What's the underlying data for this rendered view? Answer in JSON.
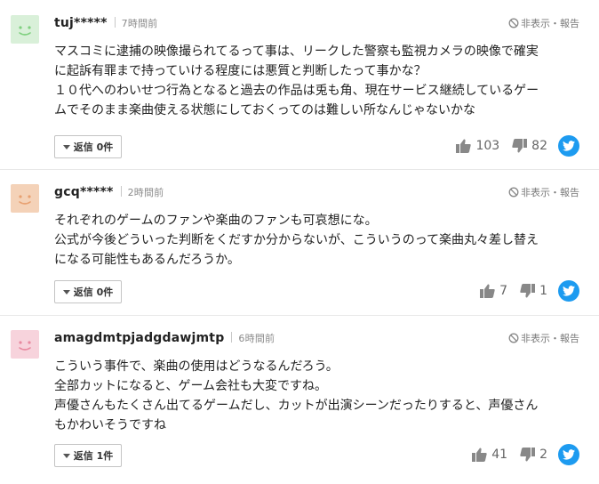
{
  "comments": [
    {
      "avatar_color": "#7fd07f",
      "avatar_bg": "#d9f0d9",
      "username": "tuj*****",
      "time": "7時間前",
      "report_label": "非表示・報告",
      "lines": [
        "マスコミに逮捕の映像撮られてるって事は、リークした警察も監視カメラの映像で確実",
        "に起訴有罪まで持っていける程度には悪質と判断したって事かな？",
        "１０代へのわいせつ行為となると過去の作品は兎も角、現在サービス継続しているゲー",
        "ムでそのまま楽曲使える状態にしておくってのは難しい所なんじゃないかな"
      ],
      "reply_label": "返信 0件",
      "likes": "103",
      "dislikes": "82"
    },
    {
      "avatar_color": "#e8a070",
      "avatar_bg": "#f4d2b8",
      "username": "gcq*****",
      "time": "2時間前",
      "report_label": "非表示・報告",
      "lines": [
        "それぞれのゲームのファンや楽曲のファンも可哀想にな。",
        "公式が今後どういった判断をくだすか分からないが、こういうのって楽曲丸々差し替え",
        "になる可能性もあるんだろうか。"
      ],
      "reply_label": "返信 0件",
      "likes": "7",
      "dislikes": "1"
    },
    {
      "avatar_color": "#e88aa0",
      "avatar_bg": "#f7d3dc",
      "username": "amagdmtpjadgdawjmtp",
      "time": "6時間前",
      "report_label": "非表示・報告",
      "lines": [
        "こういう事件で、楽曲の使用はどうなるんだろう。",
        "全部カットになると、ゲーム会社も大変ですね。",
        "声優さんもたくさん出てるゲームだし、カットが出演シーンだったりすると、声優さん",
        "もかわいそうですね"
      ],
      "reply_label": "返信 1件",
      "likes": "41",
      "dislikes": "2"
    }
  ]
}
